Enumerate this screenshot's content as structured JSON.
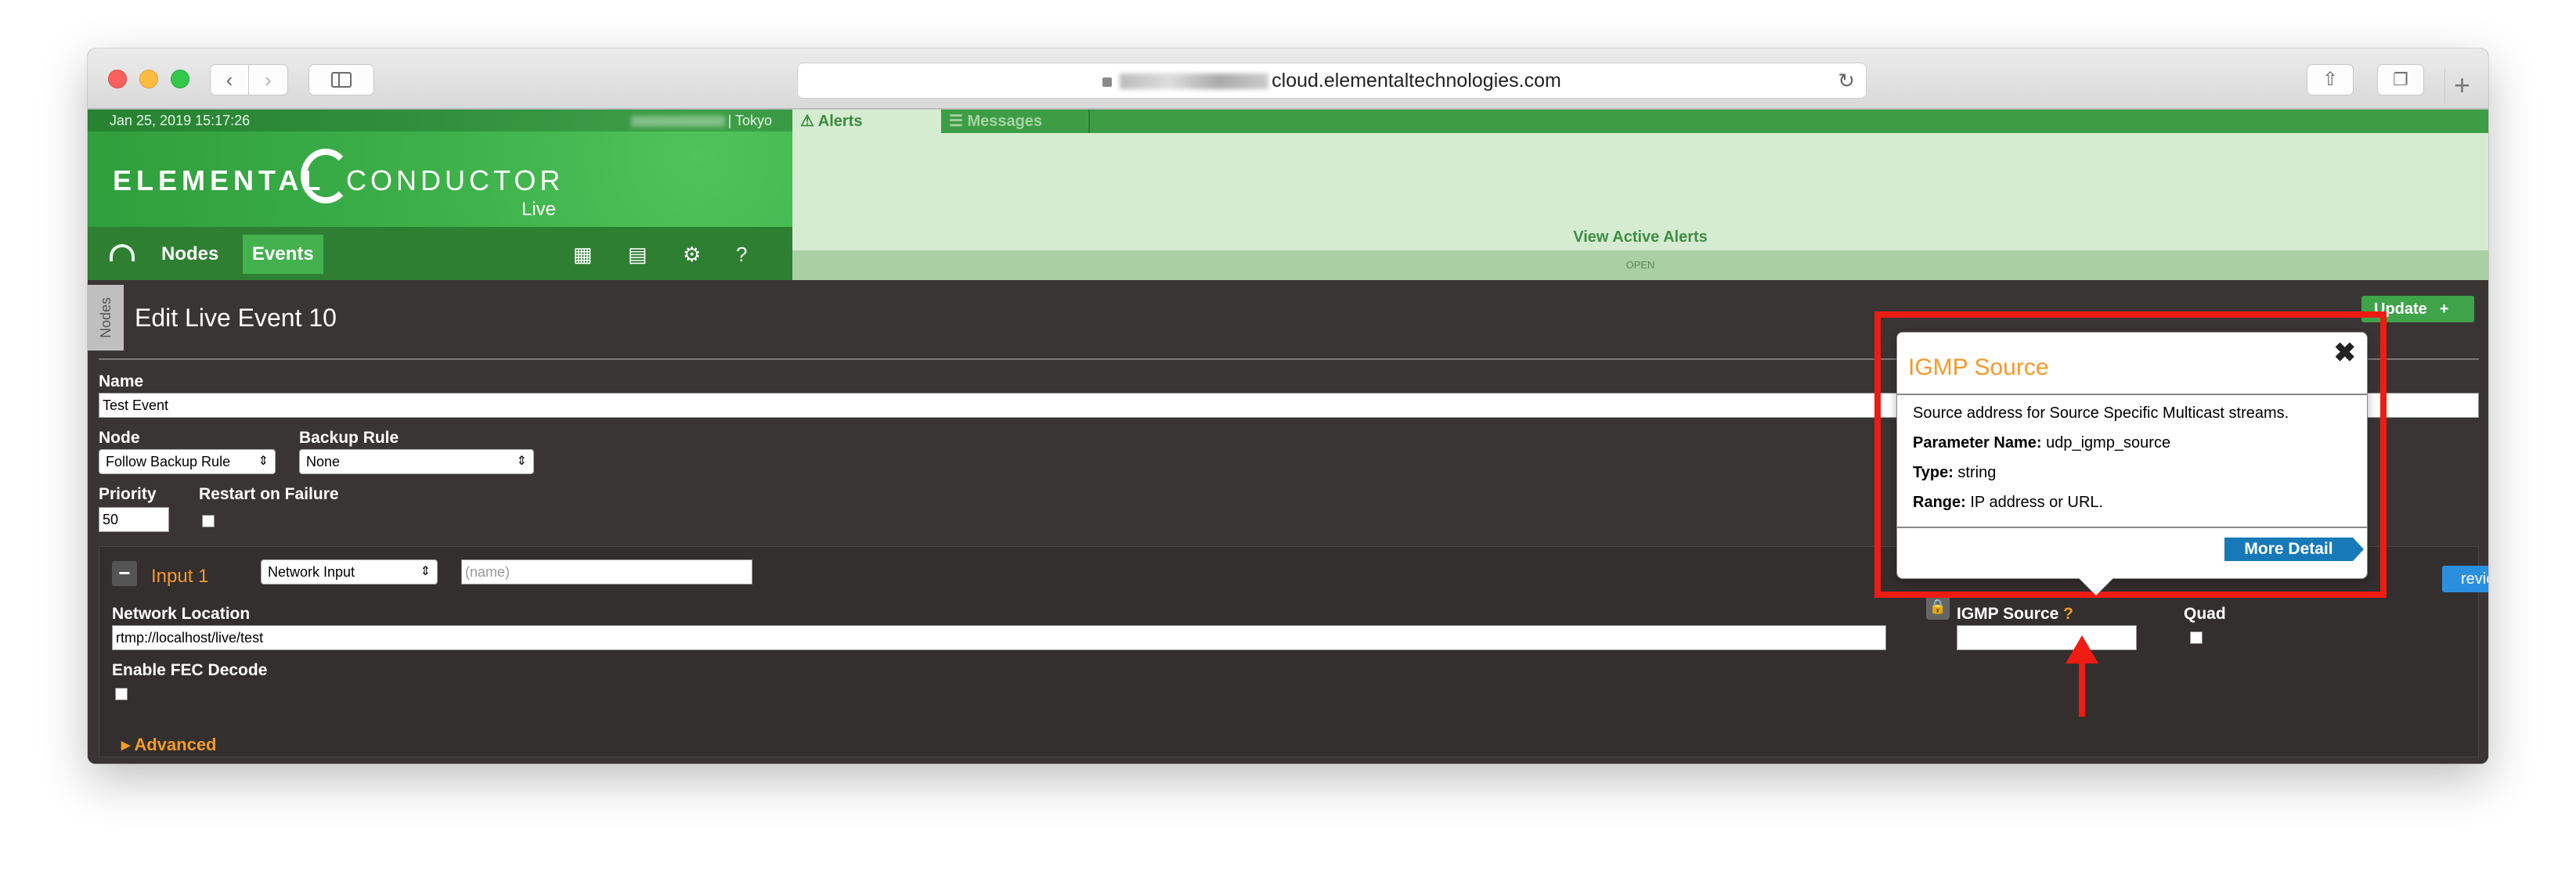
{
  "browser": {
    "url": "cloud.elementaltechnologies.com",
    "icons": [
      "back-icon",
      "forward-icon",
      "sidebar-icon",
      "lock-icon",
      "reload-icon",
      "share-icon",
      "tabs-icon",
      "new-tab-icon"
    ]
  },
  "header": {
    "datetime": "Jan 25, 2019 15:17:26",
    "location": "| Tokyo",
    "brand_elemental": "ELEMENTAL",
    "brand_conductor": "CONDUCTOR",
    "brand_live": "Live",
    "nav": [
      {
        "label": "Nodes",
        "active": false
      },
      {
        "label": "Events",
        "active": true
      }
    ],
    "nav_icons": [
      "dashboard-icon",
      "calendar-icon",
      "chart-icon",
      "gear-icon",
      "help-icon"
    ]
  },
  "alerts": {
    "tab_alerts": "Alerts",
    "tab_messages": "Messages",
    "view_active": "View Active Alerts",
    "status": "OPEN"
  },
  "event": {
    "side_tab": "Nodes",
    "title": "Edit Live Event 10",
    "update_label": "Update",
    "name_label": "Name",
    "name_value": "Test Event",
    "node_label": "Node",
    "node_value": "Follow Backup Rule",
    "backup_rule_label": "Backup Rule",
    "backup_rule_value": "None",
    "priority_label": "Priority",
    "priority_value": "50",
    "restart_label": "Restart on Failure"
  },
  "input": {
    "title": "Input 1",
    "type_value": "Network Input",
    "name_placeholder": "(name)",
    "preview_label": "review",
    "network_location_label": "Network Location",
    "network_location_value": "rtmp://localhost/live/test",
    "igmp_label": "IGMP Source",
    "igmp_help": "?",
    "quad_label": "Quad",
    "fec_label": "Enable FEC Decode",
    "advanced_label": "Advanced"
  },
  "popover": {
    "title": "IGMP Source",
    "description": "Source address for Source Specific Multicast streams.",
    "param_label": "Parameter Name:",
    "param_value": "udp_igmp_source",
    "type_label": "Type:",
    "type_value": "string",
    "range_label": "Range:",
    "range_value": "IP address or URL.",
    "more_detail": "More Detail",
    "close": "✖"
  },
  "colors": {
    "brand_green": "#3db14a",
    "accent_orange": "#f39a2b",
    "annotation_red": "#ee1c13",
    "button_blue": "#1779b8"
  }
}
